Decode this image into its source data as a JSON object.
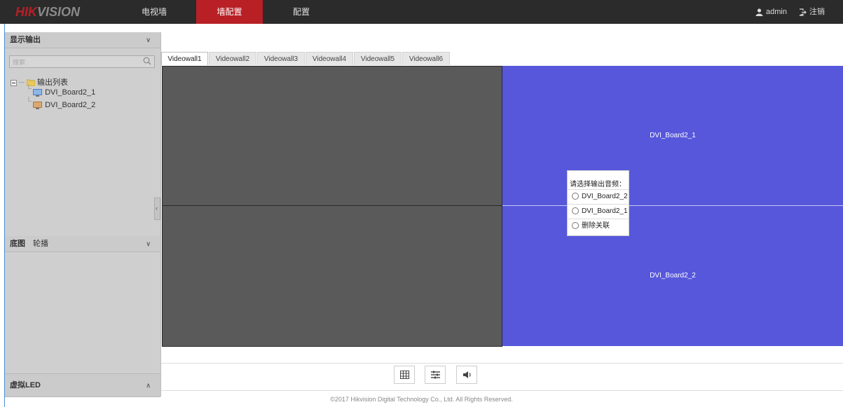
{
  "app": {
    "logo_main": "HIK",
    "logo_rest": "VISION"
  },
  "nav": {
    "items": [
      "电视墙",
      "墙配置",
      "配置"
    ],
    "active_index": 1
  },
  "user": {
    "name": "admin",
    "logout": "注销"
  },
  "sidebar": {
    "output_panel": {
      "title": "显示输出",
      "search_placeholder": "搜索"
    },
    "tree": {
      "root": "输出列表",
      "children": [
        "DVI_Board2_1",
        "DVI_Board2_2"
      ]
    },
    "panel2": {
      "tab1": "底图",
      "tab2": "轮播"
    },
    "panel3": {
      "title": "虚拟LED"
    }
  },
  "tabs": [
    "Videowall1",
    "Videowall2",
    "Videowall3",
    "Videowall4",
    "Videowall5",
    "Videowall6"
  ],
  "active_tab": 0,
  "wall": {
    "screen_top_right": "DVI_Board2_1",
    "screen_bottom_right": "DVI_Board2_2"
  },
  "audio_popup": {
    "title": "请选择输出音频：",
    "options": [
      "DVI_Board2_2",
      "DVI_Board2_1",
      "删除关联"
    ]
  },
  "toolbar": {
    "icons": [
      "grid-icon",
      "sliders-icon",
      "speaker-icon"
    ]
  },
  "footer": {
    "text": "©2017 Hikvision Digital Technology Co., Ltd. All Rights Reserved."
  },
  "colors": {
    "accent": "#b82025",
    "screen_blue": "#5757dc",
    "screen_dark": "#5a5a5a",
    "topbar": "#2b2b2b"
  }
}
